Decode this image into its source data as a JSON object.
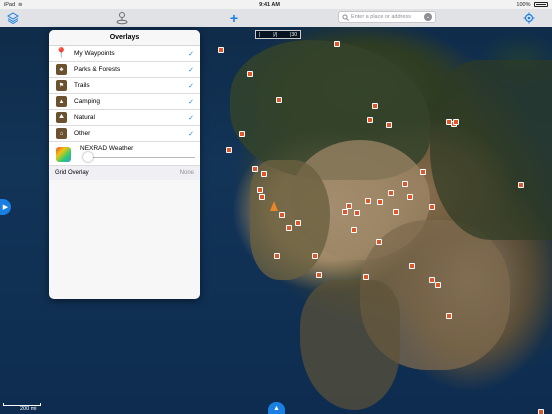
{
  "status_bar": {
    "carrier": "iPad",
    "time": "9:41 AM",
    "battery": "100%"
  },
  "toolbar": {
    "layers_icon": "layers-icon",
    "gps_icon": "gps-pin-icon",
    "add_label": "+",
    "search_placeholder": "Enter a place or address",
    "settings_icon": "gear-icon"
  },
  "ruler": {
    "left": "|",
    "mid": "|/|",
    "right": "|30"
  },
  "overlays": {
    "title": "Overlays",
    "items": [
      {
        "label": "My Waypoints",
        "icon": "pin-icon",
        "checked": true
      },
      {
        "label": "Parks & Forests",
        "icon": "park-icon",
        "checked": true
      },
      {
        "label": "Trails",
        "icon": "trail-icon",
        "checked": true
      },
      {
        "label": "Camping",
        "icon": "tent-icon",
        "checked": true
      },
      {
        "label": "Natural",
        "icon": "mountain-icon",
        "checked": true
      },
      {
        "label": "Other",
        "icon": "other-icon",
        "checked": true
      }
    ],
    "nexrad": {
      "label": "NEXRAD Weather",
      "opacity": 0.03
    },
    "grid": {
      "label": "Grid Overlay",
      "value": "None"
    }
  },
  "scale": {
    "label": "200 mi"
  },
  "colors": {
    "accent": "#1a7fe3",
    "marker": "#e0552a"
  }
}
